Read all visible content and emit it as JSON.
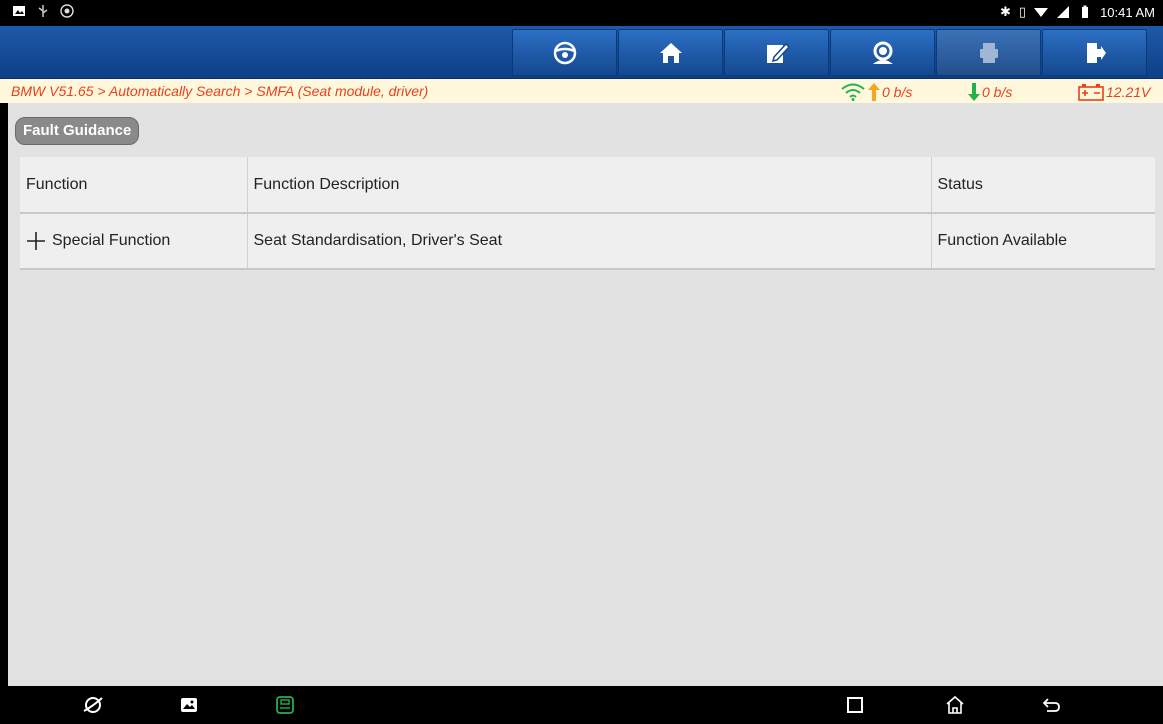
{
  "status_bar": {
    "time": "10:41 AM",
    "left_icons": [
      "notification-icon",
      "usb-icon",
      "bug-icon"
    ],
    "right_icons": [
      "bluetooth-icon",
      "vibrate-icon",
      "wifi-icon",
      "signal-icon",
      "battery-icon"
    ]
  },
  "toolbar": {
    "buttons": [
      "steering-wheel-icon",
      "home-icon",
      "edit-icon",
      "support-icon",
      "print-icon",
      "exit-icon"
    ]
  },
  "breadcrumb": {
    "text": "BMW V51.65 > Automatically Search > SMFA (Seat module, driver)",
    "upload": "0 b/s",
    "download": "0 b/s",
    "voltage": "12.21V"
  },
  "colors": {
    "breadcrumb_text": "#e8401c",
    "wifi": "#23b14d",
    "upload_arrow": "#f5a623",
    "download_arrow": "#23b14d"
  },
  "section": {
    "title": "Fault Guidance"
  },
  "table": {
    "headers": [
      "Function",
      "Function Description",
      "Status"
    ],
    "rows": [
      {
        "function": "Special Function",
        "description": "Seat Standardisation, Driver's Seat",
        "status": "Function Available"
      }
    ]
  },
  "nav_bar": {
    "icons": [
      "browser-icon",
      "gallery-icon",
      "vci-icon",
      "recents-icon",
      "home-icon",
      "back-icon"
    ]
  }
}
